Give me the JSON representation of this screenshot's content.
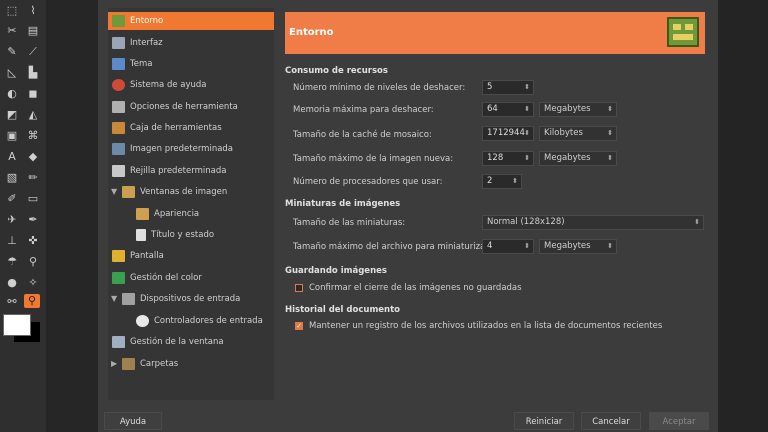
{
  "tree": {
    "items": [
      {
        "label": "Entorno",
        "icon": "card-icon"
      },
      {
        "label": "Interfaz",
        "icon": "window-icon"
      },
      {
        "label": "Tema",
        "icon": "palette-icon"
      },
      {
        "label": "Sistema de ayuda",
        "icon": "lifebuoy-icon"
      },
      {
        "label": "Opciones de herramienta",
        "icon": "tool-options-icon"
      },
      {
        "label": "Caja de herramientas",
        "icon": "toolbox-icon"
      },
      {
        "label": "Imagen predeterminada",
        "icon": "image-icon"
      },
      {
        "label": "Rejilla predeterminada",
        "icon": "grid-icon"
      },
      {
        "label": "Ventanas de imagen",
        "icon": "image-window-icon"
      },
      {
        "label": "Apariencia",
        "icon": "appearance-icon"
      },
      {
        "label": "Título y estado",
        "icon": "title-icon"
      },
      {
        "label": "Pantalla",
        "icon": "display-icon"
      },
      {
        "label": "Gestión del color",
        "icon": "color-icon"
      },
      {
        "label": "Dispositivos de entrada",
        "icon": "input-devices-icon"
      },
      {
        "label": "Controladores de entrada",
        "icon": "controller-icon"
      },
      {
        "label": "Gestión de la ventana",
        "icon": "window-manage-icon"
      },
      {
        "label": "Carpetas",
        "icon": "folder-icon"
      }
    ]
  },
  "banner": {
    "title": "Entorno"
  },
  "resources": {
    "heading": "Consumo de recursos",
    "undo_levels": {
      "label": "Número mínimo de niveles de deshacer:",
      "value": "5"
    },
    "undo_memory": {
      "label": "Memoria máxima para deshacer:",
      "value": "64",
      "unit": "Megabytes"
    },
    "tile_cache": {
      "label": "Tamaño de la caché de mosaico:",
      "value": "1712944",
      "unit": "Kilobytes"
    },
    "max_image": {
      "label": "Tamaño máximo de la imagen nueva:",
      "value": "128",
      "unit": "Megabytes"
    },
    "threads": {
      "label": "Número de procesadores que usar:",
      "value": "2"
    }
  },
  "thumbnails": {
    "heading": "Miniaturas de imágenes",
    "size": {
      "label": "Tamaño de las miniaturas:",
      "value": "Normal (128x128)"
    },
    "max_file": {
      "label": "Tamaño máximo del archivo para miniaturizar:",
      "value": "4",
      "unit": "Megabytes"
    }
  },
  "saving": {
    "heading": "Guardando imágenes",
    "confirm": {
      "label": "Confirmar el cierre de las imágenes no guardadas",
      "checked": false
    }
  },
  "history": {
    "heading": "Historial del documento",
    "keep": {
      "label": "Mantener un registro de los archivos utilizados en la lista de documentos recientes",
      "checked": true
    }
  },
  "buttons": {
    "help": "Ayuda",
    "reset": "Reiniciar",
    "cancel": "Cancelar",
    "accept": "Aceptar"
  }
}
